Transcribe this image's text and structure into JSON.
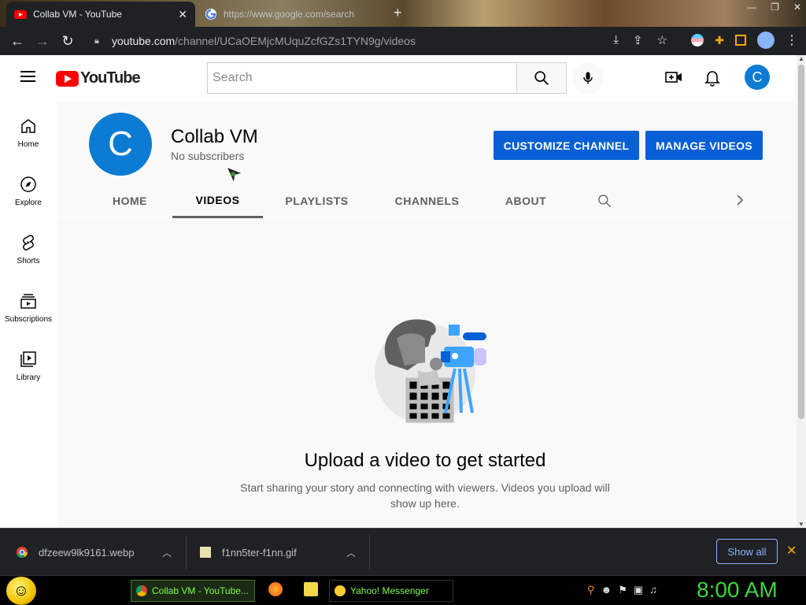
{
  "browser": {
    "tabs": [
      {
        "title": "Collab VM - YouTube",
        "active": true
      },
      {
        "title": "https://www.google.com/search",
        "active": false
      }
    ],
    "new_tab_label": "+",
    "url_host": "youtube.com",
    "url_path": "/channel/UCaOEMjcMUquZcfGZs1TYN9g/videos"
  },
  "youtube": {
    "logo_text": "YouTube",
    "search_placeholder": "Search",
    "account_initial": "C",
    "guide": [
      {
        "label": "Home",
        "icon": "home-icon"
      },
      {
        "label": "Explore",
        "icon": "compass-icon"
      },
      {
        "label": "Shorts",
        "icon": "shorts-icon"
      },
      {
        "label": "Subscriptions",
        "icon": "subscriptions-icon"
      },
      {
        "label": "Library",
        "icon": "library-icon"
      }
    ],
    "channel": {
      "initial": "C",
      "name": "Collab VM",
      "subscribers": "No subscribers",
      "customize_button": "CUSTOMIZE CHANNEL",
      "manage_button": "MANAGE VIDEOS"
    },
    "tabs": [
      {
        "label": "HOME",
        "selected": false
      },
      {
        "label": "VIDEOS",
        "selected": true
      },
      {
        "label": "PLAYLISTS",
        "selected": false
      },
      {
        "label": "CHANNELS",
        "selected": false
      },
      {
        "label": "ABOUT",
        "selected": false
      }
    ],
    "empty_state": {
      "title": "Upload a video to get started",
      "description": "Start sharing your story and connecting with viewers. Videos you upload will show up here."
    }
  },
  "downloads": {
    "items": [
      {
        "filename": "dfzeew9lk9161.webp"
      },
      {
        "filename": "f1nn5ter-f1nn.gif"
      }
    ],
    "show_all": "Show all"
  },
  "taskbar": {
    "tasks": [
      {
        "label": "Collab VM - YouTube...",
        "active": true
      },
      {
        "label": "Yahoo! Messenger",
        "active": false
      }
    ],
    "clock": "8:00 AM"
  },
  "colors": {
    "youtube_red": "#ff0000",
    "youtube_blue": "#065fd4",
    "avatar_blue": "#0b7bd3",
    "clock_green": "#3dd43d"
  }
}
